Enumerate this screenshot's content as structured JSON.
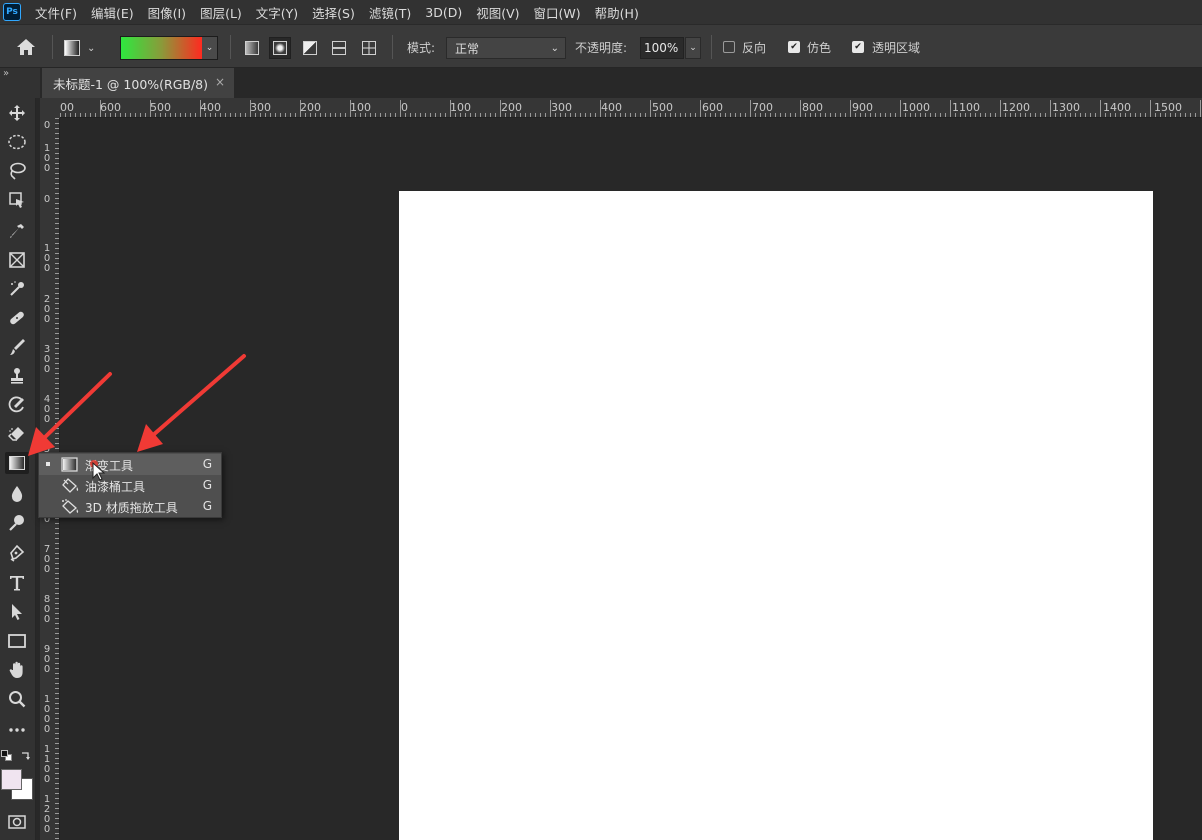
{
  "app": {
    "logo_text": "Ps"
  },
  "menu": [
    "文件(F)",
    "编辑(E)",
    "图像(I)",
    "图层(L)",
    "文字(Y)",
    "选择(S)",
    "滤镜(T)",
    "3D(D)",
    "视图(V)",
    "窗口(W)",
    "帮助(H)"
  ],
  "options": {
    "mode_label": "模式:",
    "mode_value": "正常",
    "opacity_label": "不透明度:",
    "opacity_value": "100%",
    "reverse_label": "反向",
    "reverse_checked": false,
    "dither_label": "仿色",
    "dither_checked": true,
    "transparency_label": "透明区域",
    "transparency_checked": true,
    "gradient_colors": [
      "#2ee83f",
      "#ff2a20"
    ]
  },
  "panel": {
    "collapse_glyph": "»"
  },
  "document": {
    "tab_title": "未标题-1 @ 100%(RGB/8)",
    "close_glyph": "×"
  },
  "ruler": {
    "top_labels": [
      "00",
      "600",
      "500",
      "400",
      "300",
      "200",
      "100",
      "0",
      "100",
      "200",
      "300",
      "400",
      "500",
      "600",
      "700",
      "800",
      "900",
      "1000",
      "1100",
      "1200",
      "1300",
      "1400",
      "1500"
    ],
    "left_labels": [
      "0",
      "100",
      "0",
      "100",
      "200",
      "300",
      "400",
      "500",
      "600",
      "700",
      "800",
      "900",
      "1000",
      "1100",
      "1200"
    ]
  },
  "flyout": {
    "items": [
      {
        "label": "渐变工具",
        "shortcut": "G",
        "icon": "gradient-icon"
      },
      {
        "label": "油漆桶工具",
        "shortcut": "G",
        "icon": "paint-bucket-icon"
      },
      {
        "label": "3D 材质拖放工具",
        "shortcut": "G",
        "icon": "3d-material-drop-icon"
      }
    ]
  },
  "colors": {
    "annotation_arrow": "#f03a35",
    "canvas": "#ffffff",
    "workspace": "#282828"
  }
}
